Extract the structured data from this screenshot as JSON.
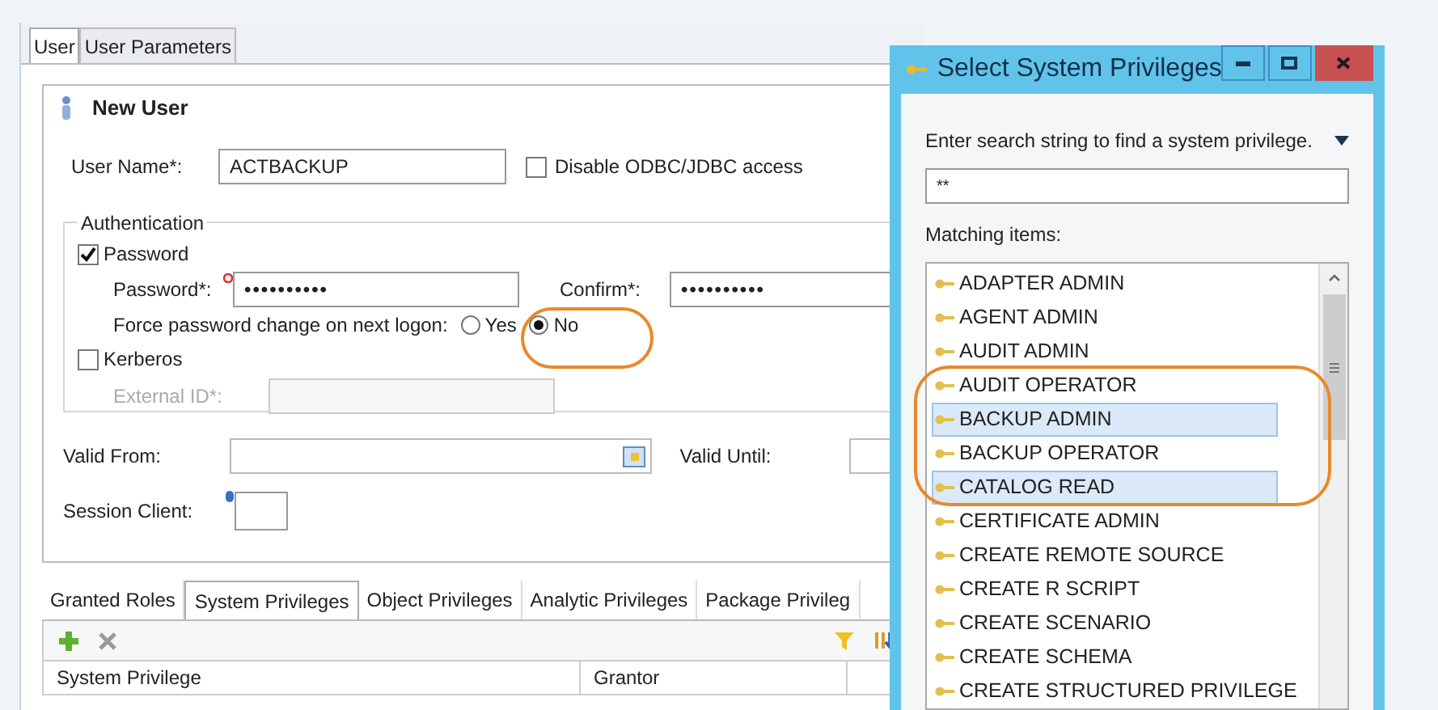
{
  "main_tabs": [
    {
      "label": "User",
      "selected": true
    },
    {
      "label": "User Parameters",
      "selected": false
    }
  ],
  "form": {
    "title": "New User",
    "user_name": {
      "label": "User Name*:",
      "value": "ACTBACKUP"
    },
    "disable_odbc": {
      "label": "Disable ODBC/JDBC access",
      "checked": false
    },
    "authentication": {
      "legend": "Authentication",
      "password": {
        "label": "Password",
        "checked": true
      },
      "password_field": {
        "label": "Password*:",
        "value": "••••••••••"
      },
      "confirm_field": {
        "label": "Confirm*:",
        "value": "••••••••••"
      },
      "force_change": {
        "label": "Force password change on next logon:",
        "options": [
          {
            "label": "Yes",
            "selected": false
          },
          {
            "label": "No",
            "selected": true
          }
        ]
      },
      "kerberos": {
        "label": "Kerberos",
        "checked": false
      },
      "external_id": {
        "label": "External ID*:",
        "disabled": true
      }
    },
    "valid_from": {
      "label": "Valid From:"
    },
    "valid_until": {
      "label": "Valid Until:"
    },
    "session_client": {
      "label": "Session Client:"
    }
  },
  "detail_tabs": [
    {
      "label": "Granted Roles",
      "selected": false
    },
    {
      "label": "System Privileges",
      "selected": true
    },
    {
      "label": "Object Privileges",
      "selected": false
    },
    {
      "label": "Analytic Privileges",
      "selected": false
    },
    {
      "label": "Package Privileg",
      "selected": false
    }
  ],
  "table": {
    "columns": [
      "System Privilege",
      "Grantor"
    ]
  },
  "dialog": {
    "title": "Select System Privileges",
    "prompt": "Enter search string to find a system privilege.",
    "search": {
      "value": "**"
    },
    "list_label": "Matching items:",
    "items": [
      {
        "label": "ADAPTER ADMIN",
        "selected": false
      },
      {
        "label": "AGENT ADMIN",
        "selected": false
      },
      {
        "label": "AUDIT ADMIN",
        "selected": false
      },
      {
        "label": "AUDIT OPERATOR",
        "selected": false
      },
      {
        "label": "BACKUP ADMIN",
        "selected": true
      },
      {
        "label": "BACKUP OPERATOR",
        "selected": false
      },
      {
        "label": "CATALOG READ",
        "selected": true
      },
      {
        "label": "CERTIFICATE ADMIN",
        "selected": false
      },
      {
        "label": "CREATE REMOTE SOURCE",
        "selected": false
      },
      {
        "label": "CREATE R SCRIPT",
        "selected": false
      },
      {
        "label": "CREATE SCENARIO",
        "selected": false
      },
      {
        "label": "CREATE SCHEMA",
        "selected": false
      },
      {
        "label": "CREATE STRUCTURED PRIVILEGE",
        "selected": false
      }
    ]
  },
  "callouts": [
    {
      "kind": "ellipse"
    },
    {
      "kind": "ellipse"
    }
  ]
}
